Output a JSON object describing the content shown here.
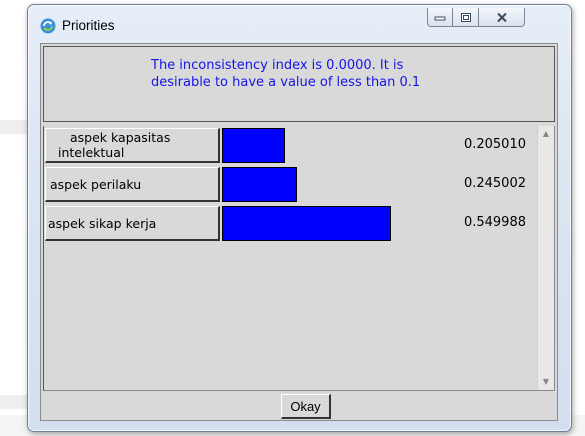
{
  "window": {
    "title": "Priorities",
    "icon": "refresh-icon"
  },
  "title_controls": [
    {
      "name": "minimize",
      "icon": "minimize-icon"
    },
    {
      "name": "maximize",
      "icon": "maximize-icon"
    },
    {
      "name": "close",
      "icon": "close-icon"
    }
  ],
  "message": "The inconsistency index is 0.0000.  It is desirable to have a value of less than 0.1",
  "priorities": [
    {
      "label": "aspek kapasitas intelektual",
      "value": "0.205010",
      "weight": 0.20501
    },
    {
      "label": "aspek perilaku",
      "value": "0.245002",
      "weight": 0.245002
    },
    {
      "label": "aspek sikap kerja",
      "value": "0.549988",
      "weight": 0.549988
    }
  ],
  "okay_label": "Okay",
  "colors": {
    "bar": "#0000ff",
    "message_text": "#1515e6",
    "panel_bg": "#d9d9d9"
  }
}
